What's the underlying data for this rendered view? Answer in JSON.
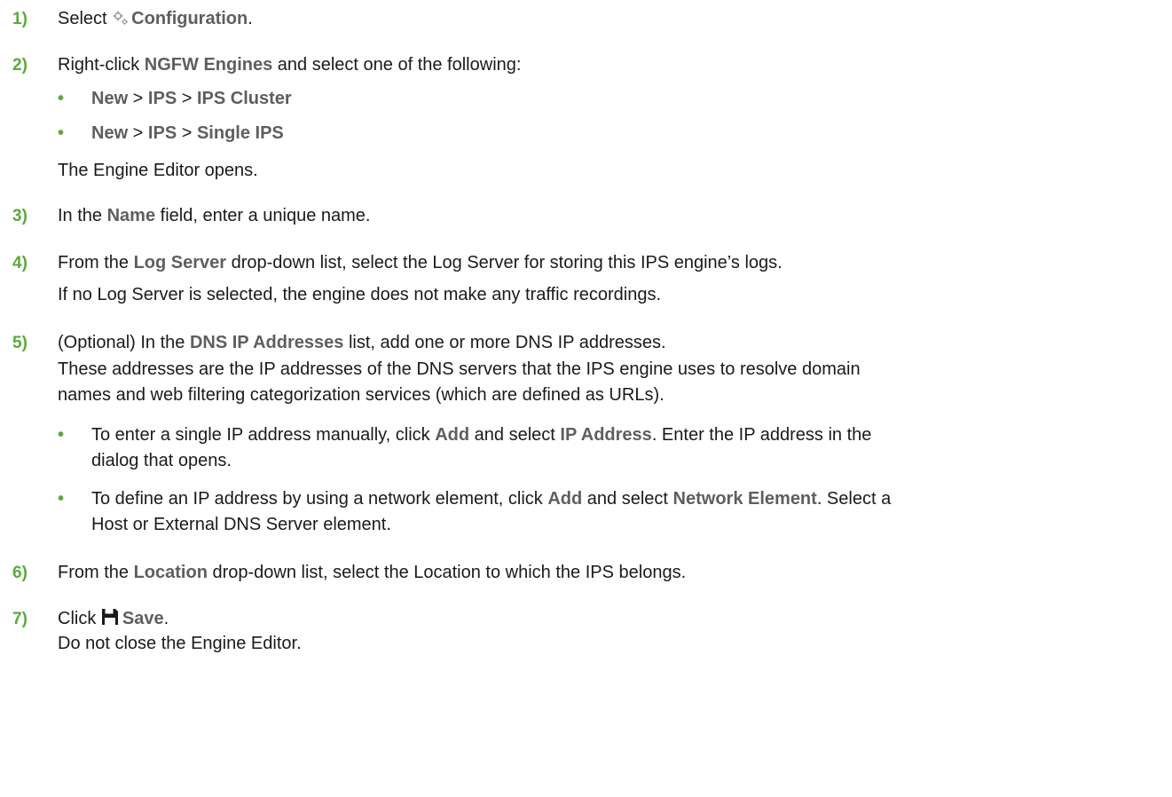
{
  "steps": [
    {
      "num": "1)",
      "pre": "Select ",
      "bold": "Configuration",
      "post": "."
    },
    {
      "num": "2)",
      "pre": "Right-click ",
      "bold": "NGFW Engines",
      "post": " and select one of the following:",
      "options": [
        {
          "a": "New",
          "sep1": " > ",
          "b": "IPS",
          "sep2": " > ",
          "c": "IPS Cluster"
        },
        {
          "a": "New",
          "sep1": " > ",
          "b": "IPS",
          "sep2": " > ",
          "c": "Single IPS"
        }
      ],
      "result": "The Engine Editor opens."
    },
    {
      "num": "3)",
      "pre": "In the ",
      "bold": "Name",
      "post": " field, enter a unique name."
    },
    {
      "num": "4)",
      "pre": "From the ",
      "bold": "Log Server",
      "post": " drop-down list, select the Log Server for storing this IPS engine’s logs.",
      "note": "If no Log Server is selected, the engine does not make any traffic recordings."
    },
    {
      "num": "5)",
      "pre": "(Optional) In the ",
      "bold": "DNS IP Addresses",
      "post": " list, add one or more DNS IP addresses.",
      "note1": "These addresses are the IP addresses of the DNS servers that the IPS engine uses to resolve domain",
      "note2": "names and web filtering categorization services (which are defined as URLs).",
      "bullets": [
        {
          "l1_pre": "To enter a single IP address manually, click ",
          "l1_b1": "Add",
          "l1_mid": " and select ",
          "l1_b2": "IP Address",
          "l1_post": ". Enter the IP address in the",
          "l2": "dialog that opens."
        },
        {
          "l1_pre": "To define an IP address by using a network element, click ",
          "l1_b1": "Add",
          "l1_mid": " and select ",
          "l1_b2": "Network Element",
          "l1_post": ". Select a",
          "l2": "Host or External DNS Server element."
        }
      ]
    },
    {
      "num": "6)",
      "pre": "From the ",
      "bold": "Location",
      "post": " drop-down list, select the Location to which the IPS belongs."
    },
    {
      "num": "7)",
      "pre": "Click ",
      "bold": "Save",
      "post": ".",
      "note": "Do not close the Engine Editor."
    }
  ],
  "bullet_glyph": "•",
  "icons": {
    "step1": "gear-icon",
    "step7": "save-icon"
  },
  "colors": {
    "step_number": "#5aaa3c",
    "bold_term": "#5e5e5e",
    "text": "#1a1a1a"
  }
}
